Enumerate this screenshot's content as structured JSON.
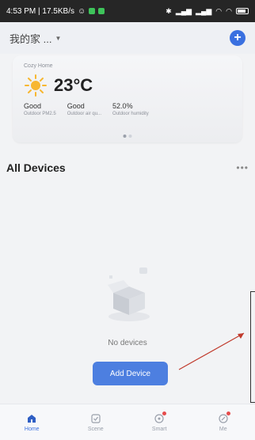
{
  "status_bar": {
    "time_speed": "4:53 PM | 17.5KB/s",
    "battery_label": "",
    "colors": {
      "bg": "#262626",
      "app_icon": "#3ec35a"
    }
  },
  "header": {
    "home_name": "我的家 ...",
    "chevron_icon": "chevron-down-icon",
    "add_icon": "plus-circle-icon",
    "accent": "#3a70e0"
  },
  "weather": {
    "card_title": "Cozy Home",
    "weather_icon": "sun-icon",
    "temperature": "23°C",
    "metrics": [
      {
        "value": "Good",
        "label": "Outdoor PM2.5"
      },
      {
        "value": "Good",
        "label": "Outdoor air qu..."
      },
      {
        "value": "52.0%",
        "label": "Outdoor humidity"
      }
    ],
    "page_indicator": {
      "count": 2,
      "active": 1
    }
  },
  "devices": {
    "title": "All Devices",
    "more_icon": "more-horizontal-icon",
    "empty_text": "No devices",
    "add_button_label": "Add Device",
    "illustration_icon": "empty-box-icon"
  },
  "bottom_nav": {
    "items": [
      {
        "label": "Home",
        "icon": "home-icon",
        "active": true
      },
      {
        "label": "Scene",
        "icon": "scene-checkbox-icon",
        "active": false
      },
      {
        "label": "Smart",
        "icon": "smart-icon",
        "active": false,
        "badge": true
      },
      {
        "label": "Me",
        "icon": "me-icon",
        "active": false,
        "badge": true
      }
    ]
  }
}
